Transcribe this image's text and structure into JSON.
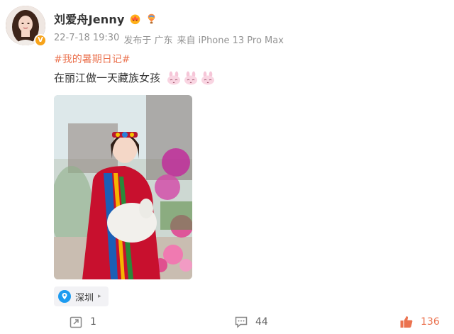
{
  "user": {
    "name": "刘爱舟Jenny",
    "verified_mark": "V",
    "badges": [
      "crown-badge-icon",
      "balloon-badge-icon"
    ]
  },
  "meta": {
    "time": "22-7-18 19:30",
    "posted_from": "发布于 广东",
    "device": "来自 iPhone 13 Pro Max"
  },
  "post": {
    "hashtag": "#我的暑期日记#",
    "text": "在丽江做一天藏族女孩",
    "emoji": [
      "bunny-emoji-icon",
      "bunny-emoji-icon",
      "bunny-emoji-icon"
    ]
  },
  "location": {
    "label": "深圳",
    "icon": "location-pin-icon",
    "arrow": "▸"
  },
  "actions": {
    "repost_count": "1",
    "comment_count": "44",
    "like_count": "136"
  },
  "colors": {
    "accent": "#eb7350",
    "meta": "#939393",
    "verified": "#f7a31a",
    "location_pin": "#1c9bf0"
  }
}
